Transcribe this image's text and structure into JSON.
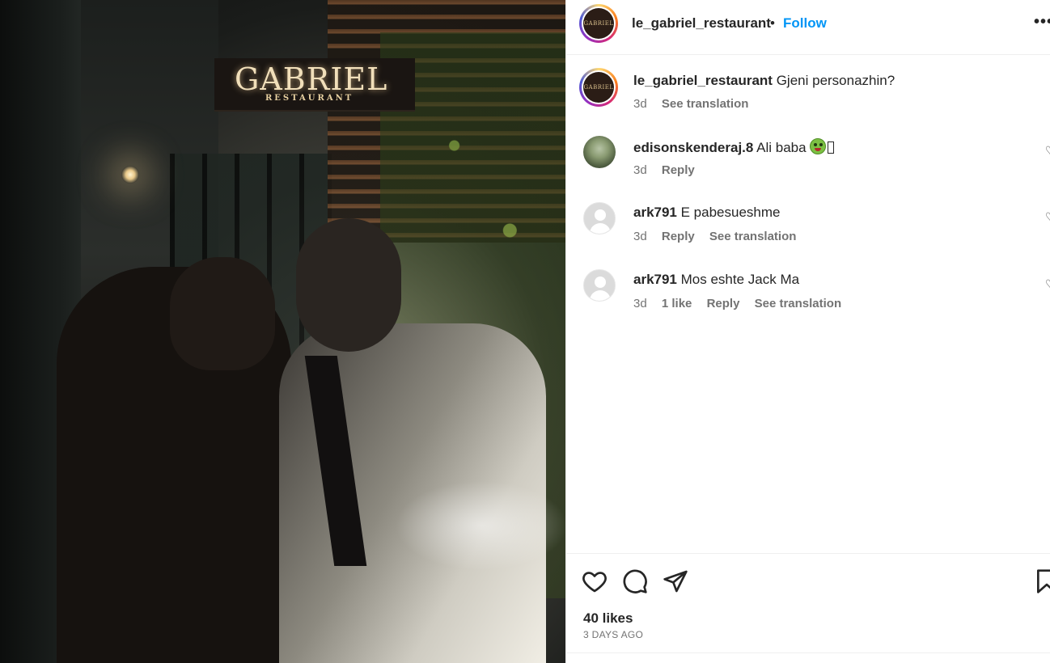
{
  "photo": {
    "sign_title": "GABRIEL",
    "sign_subtitle": "RESTAURANT",
    "avatar_logo_text": "GABRIEL"
  },
  "header": {
    "username": "le_gabriel_restaurant",
    "separator": "•",
    "follow_label": "Follow",
    "more_label": "•••"
  },
  "caption": {
    "username": "le_gabriel_restaurant",
    "text": "Gjeni personazhin?",
    "age": "3d",
    "see_translation": "See translation"
  },
  "comments": [
    {
      "username": "edisonskenderaj.8",
      "text": "Ali baba",
      "age": "3d",
      "reply": "Reply",
      "avatar": "photo"
    },
    {
      "username": "ark791",
      "text": "E pabesueshme",
      "age": "3d",
      "reply": "Reply",
      "see_translation": "See translation",
      "avatar": "default"
    },
    {
      "username": "ark791",
      "text": "Mos eshte Jack Ma",
      "age": "3d",
      "likes": "1 like",
      "reply": "Reply",
      "see_translation": "See translation",
      "avatar": "default"
    }
  ],
  "actions": {
    "like_icon": "heart-icon",
    "comment_icon": "comment-icon",
    "share_icon": "send-icon",
    "save_icon": "bookmark-icon",
    "likes_count": "40 likes",
    "timestamp": "3 DAYS AGO"
  },
  "colors": {
    "accent": "#0095f6",
    "text_primary": "#262626",
    "text_secondary": "#737373",
    "divider": "#efefef"
  }
}
